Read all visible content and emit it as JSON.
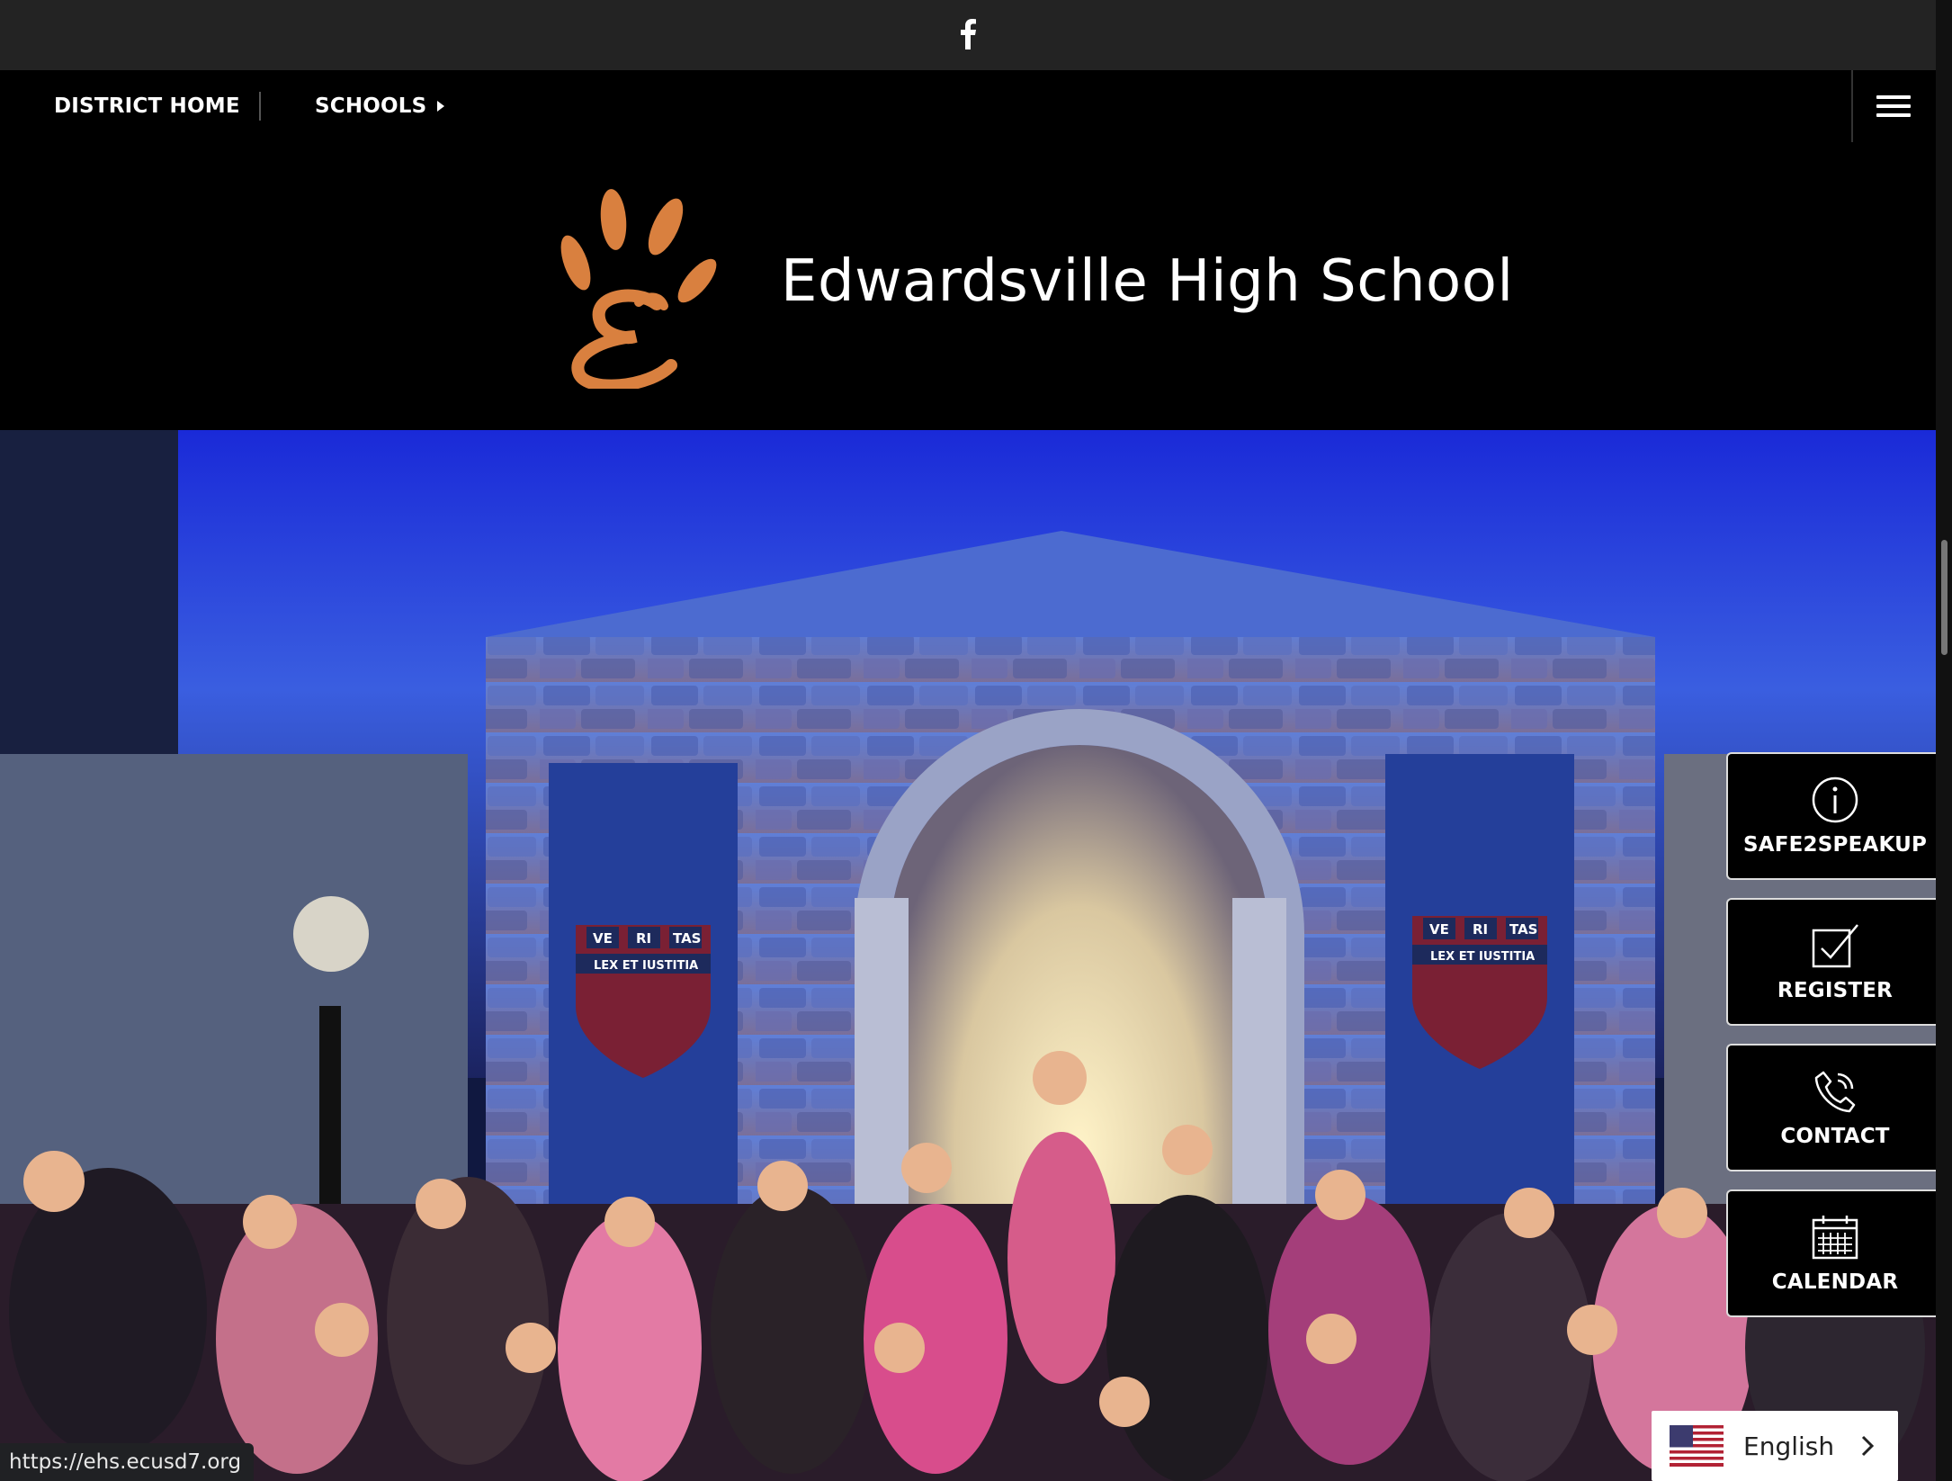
{
  "top_bar": {
    "social_icon": "facebook-icon"
  },
  "nav": {
    "district_home": "DISTRICT HOME",
    "schools": "SCHOOLS",
    "menu_icon": "hamburger-menu-icon"
  },
  "header": {
    "school_name": "Edwardsville High School",
    "logo_color": "#d9803f"
  },
  "hero": {
    "banner_left": {
      "top": [
        "VE",
        "RI",
        "TAS"
      ],
      "bottom": "LEX ET IUSTITIA"
    },
    "banner_right": {
      "top": [
        "VE",
        "RI",
        "TAS"
      ],
      "bottom": "LEX ET IUSTITIA"
    }
  },
  "quick_links": [
    {
      "label": "SAFE2SPEAKUP",
      "icon": "info-circle-icon"
    },
    {
      "label": "REGISTER",
      "icon": "checkbox-icon"
    },
    {
      "label": "CONTACT",
      "icon": "phone-icon"
    },
    {
      "label": "CALENDAR",
      "icon": "calendar-icon"
    }
  ],
  "status_bar": {
    "url": "https://ehs.ecusd7.org"
  },
  "language": {
    "selected": "English",
    "flag": "us-flag-icon"
  }
}
